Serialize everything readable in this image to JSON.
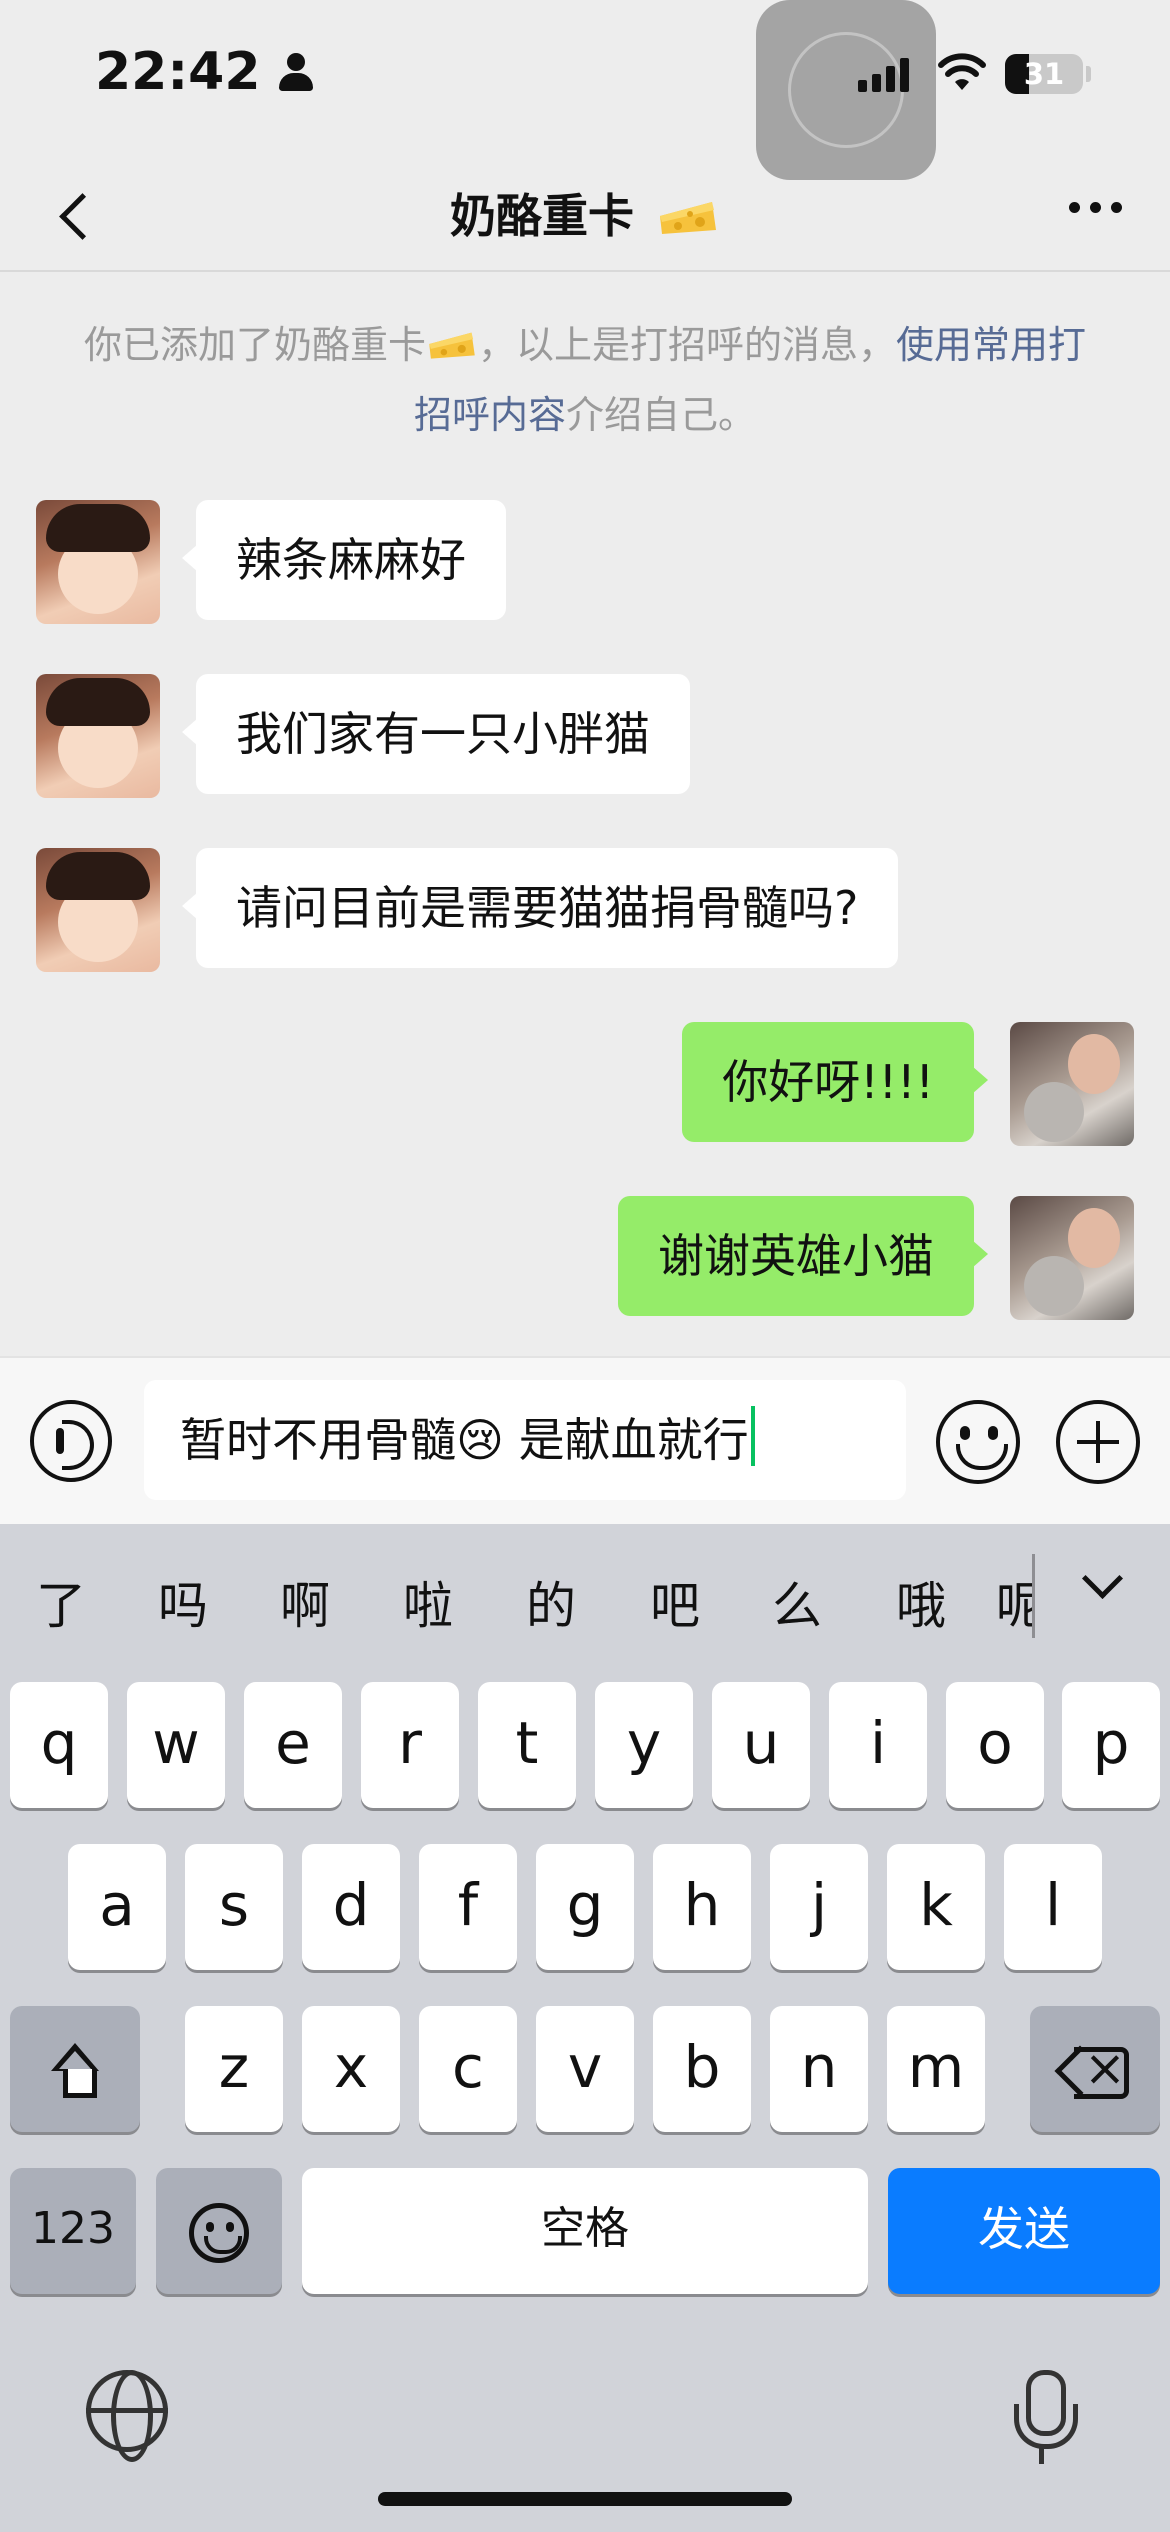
{
  "status": {
    "time": "22:42",
    "battery": "31"
  },
  "nav": {
    "title": "奶酪重卡"
  },
  "notice": {
    "part1": "你已添加了奶酪重卡",
    "part2": "，以上是打招呼的消息，",
    "link": "使用常用打招呼内容",
    "part3": "介绍自己。"
  },
  "messages": [
    {
      "side": "left",
      "text": "辣条麻麻好"
    },
    {
      "side": "left",
      "text": "我们家有一只小胖猫"
    },
    {
      "side": "left",
      "text": "请问目前是需要猫猫捐骨髓吗?"
    },
    {
      "side": "right",
      "text": "你好呀!!!!"
    },
    {
      "side": "right",
      "text": "谢谢英雄小猫"
    }
  ],
  "input": {
    "text_before": "暂时不用骨髓",
    "emoji": "😢",
    "text_after": " 是献血就行"
  },
  "keyboard": {
    "candidates": [
      "了",
      "吗",
      "啊",
      "啦",
      "的",
      "吧",
      "么",
      "哦",
      "呢"
    ],
    "row1": [
      "q",
      "w",
      "e",
      "r",
      "t",
      "y",
      "u",
      "i",
      "o",
      "p"
    ],
    "row2": [
      "a",
      "s",
      "d",
      "f",
      "g",
      "h",
      "j",
      "k",
      "l"
    ],
    "row3": [
      "z",
      "x",
      "c",
      "v",
      "b",
      "n",
      "m"
    ],
    "num_key": "123",
    "space_key": "空格",
    "send_key": "发送"
  },
  "icons": {
    "back": "chevron-left-icon",
    "more": "ellipsis-icon",
    "voice": "voice-icon",
    "emoji": "emoji-icon",
    "plus": "plus-icon",
    "globe": "globe-icon",
    "mic": "microphone-icon"
  },
  "colors": {
    "bubble_right": "#95ec69",
    "send_key": "#0a7cff",
    "link": "#576b95",
    "caret": "#07c160"
  }
}
